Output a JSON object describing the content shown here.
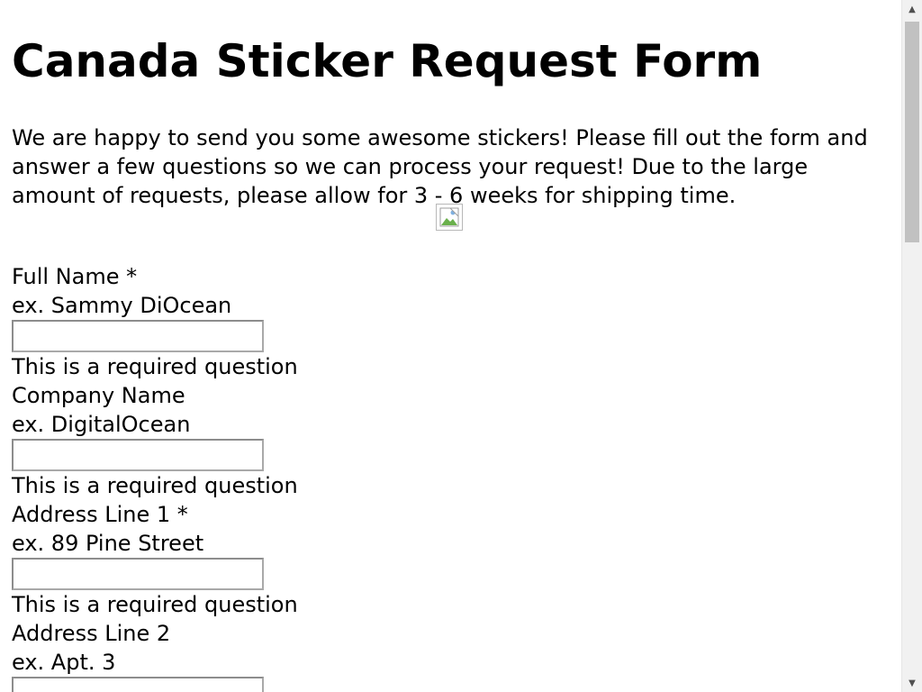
{
  "page": {
    "title": "Canada Sticker Request Form",
    "intro": "We are happy to send you some awesome stickers! Please fill out the form and answer a few questions so we can process your request! Due to the large amount of requests, please allow for 3 - 6 weeks for shipping time."
  },
  "form": {
    "fields": [
      {
        "label": "Full Name *",
        "hint": "ex. Sammy DiOcean",
        "value": "",
        "error": "This is a required question"
      },
      {
        "label": "Company Name",
        "hint": "ex. DigitalOcean",
        "value": "",
        "error": "This is a required question"
      },
      {
        "label": "Address Line 1 *",
        "hint": "ex. 89 Pine Street",
        "value": "",
        "error": "This is a required question"
      },
      {
        "label": "Address Line 2",
        "hint": "ex. Apt. 3",
        "value": "",
        "error": ""
      }
    ]
  },
  "icons": {
    "broken_image": "broken-image-icon",
    "scroll_up": "scroll-up-arrow-icon",
    "scroll_down": "scroll-down-arrow-icon"
  },
  "scroll": {
    "position_fraction": 0.0,
    "visible_fraction": 0.34
  },
  "colors": {
    "background": "#ffffff",
    "text": "#000000",
    "input_border": "#a9a9a9",
    "scrollbar_track": "#f1f1f1",
    "scrollbar_thumb": "#c1c1c1"
  }
}
